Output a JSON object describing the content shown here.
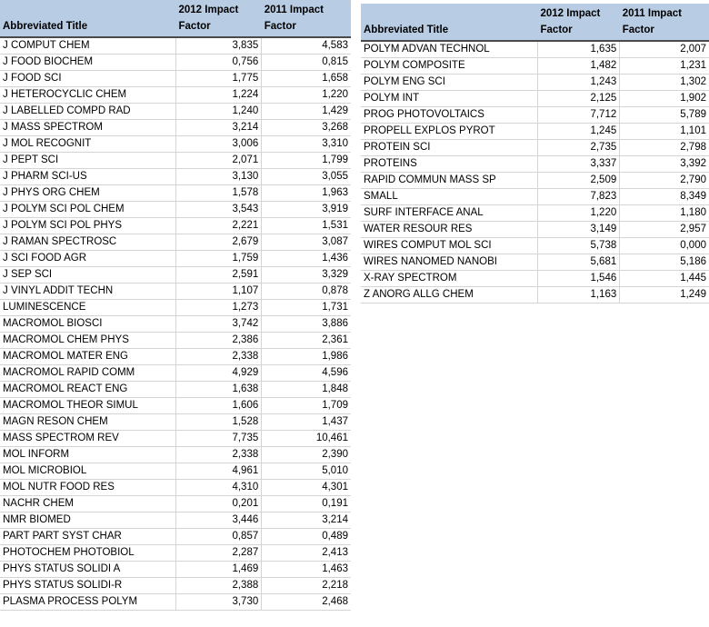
{
  "headers": {
    "title": "Abbreviated Title",
    "col2012_line1": "2012 Impact",
    "col2012_line2": "Factor",
    "col2011_line1": "2011 Impact",
    "col2011_line2": "Factor"
  },
  "left_table": [
    {
      "title": "J COMPUT CHEM",
      "if2012": "3,835",
      "if2011": "4,583"
    },
    {
      "title": "J FOOD BIOCHEM",
      "if2012": "0,756",
      "if2011": "0,815"
    },
    {
      "title": "J FOOD SCI",
      "if2012": "1,775",
      "if2011": "1,658"
    },
    {
      "title": "J HETEROCYCLIC CHEM",
      "if2012": "1,224",
      "if2011": "1,220"
    },
    {
      "title": "J LABELLED COMPD RAD",
      "if2012": "1,240",
      "if2011": "1,429"
    },
    {
      "title": "J MASS SPECTROM",
      "if2012": "3,214",
      "if2011": "3,268"
    },
    {
      "title": "J MOL RECOGNIT",
      "if2012": "3,006",
      "if2011": "3,310"
    },
    {
      "title": "J PEPT SCI",
      "if2012": "2,071",
      "if2011": "1,799"
    },
    {
      "title": "J PHARM SCI-US",
      "if2012": "3,130",
      "if2011": "3,055"
    },
    {
      "title": "J PHYS ORG CHEM",
      "if2012": "1,578",
      "if2011": "1,963"
    },
    {
      "title": "J POLYM SCI POL CHEM",
      "if2012": "3,543",
      "if2011": "3,919"
    },
    {
      "title": "J POLYM SCI POL PHYS",
      "if2012": "2,221",
      "if2011": "1,531"
    },
    {
      "title": "J RAMAN SPECTROSC",
      "if2012": "2,679",
      "if2011": "3,087"
    },
    {
      "title": "J SCI FOOD AGR",
      "if2012": "1,759",
      "if2011": "1,436"
    },
    {
      "title": "J SEP SCI",
      "if2012": "2,591",
      "if2011": "3,329"
    },
    {
      "title": "J VINYL ADDIT TECHN",
      "if2012": "1,107",
      "if2011": "0,878"
    },
    {
      "title": "LUMINESCENCE",
      "if2012": "1,273",
      "if2011": "1,731"
    },
    {
      "title": "MACROMOL BIOSCI",
      "if2012": "3,742",
      "if2011": "3,886"
    },
    {
      "title": "MACROMOL CHEM PHYS",
      "if2012": "2,386",
      "if2011": "2,361"
    },
    {
      "title": "MACROMOL MATER ENG",
      "if2012": "2,338",
      "if2011": "1,986"
    },
    {
      "title": "MACROMOL RAPID COMM",
      "if2012": "4,929",
      "if2011": "4,596"
    },
    {
      "title": "MACROMOL REACT ENG",
      "if2012": "1,638",
      "if2011": "1,848"
    },
    {
      "title": "MACROMOL THEOR SIMUL",
      "if2012": "1,606",
      "if2011": "1,709"
    },
    {
      "title": "MAGN RESON CHEM",
      "if2012": "1,528",
      "if2011": "1,437"
    },
    {
      "title": "MASS SPECTROM REV",
      "if2012": "7,735",
      "if2011": "10,461"
    },
    {
      "title": "MOL INFORM",
      "if2012": "2,338",
      "if2011": "2,390"
    },
    {
      "title": "MOL MICROBIOL",
      "if2012": "4,961",
      "if2011": "5,010"
    },
    {
      "title": "MOL NUTR FOOD RES",
      "if2012": "4,310",
      "if2011": "4,301"
    },
    {
      "title": "NACHR CHEM",
      "if2012": "0,201",
      "if2011": "0,191"
    },
    {
      "title": "NMR BIOMED",
      "if2012": "3,446",
      "if2011": "3,214"
    },
    {
      "title": "PART PART SYST CHAR",
      "if2012": "0,857",
      "if2011": "0,489"
    },
    {
      "title": "PHOTOCHEM PHOTOBIOL",
      "if2012": "2,287",
      "if2011": "2,413"
    },
    {
      "title": "PHYS STATUS SOLIDI A",
      "if2012": "1,469",
      "if2011": "1,463"
    },
    {
      "title": "PHYS STATUS SOLIDI-R",
      "if2012": "2,388",
      "if2011": "2,218"
    },
    {
      "title": "PLASMA PROCESS POLYM",
      "if2012": "3,730",
      "if2011": "2,468"
    }
  ],
  "right_table": [
    {
      "title": "POLYM ADVAN TECHNOL",
      "if2012": "1,635",
      "if2011": "2,007"
    },
    {
      "title": "POLYM COMPOSITE",
      "if2012": "1,482",
      "if2011": "1,231"
    },
    {
      "title": "POLYM ENG SCI",
      "if2012": "1,243",
      "if2011": "1,302"
    },
    {
      "title": "POLYM INT",
      "if2012": "2,125",
      "if2011": "1,902"
    },
    {
      "title": "PROG PHOTOVOLTAICS",
      "if2012": "7,712",
      "if2011": "5,789"
    },
    {
      "title": "PROPELL EXPLOS PYROT",
      "if2012": "1,245",
      "if2011": "1,101"
    },
    {
      "title": "PROTEIN SCI",
      "if2012": "2,735",
      "if2011": "2,798"
    },
    {
      "title": "PROTEINS",
      "if2012": "3,337",
      "if2011": "3,392"
    },
    {
      "title": "RAPID COMMUN MASS SP",
      "if2012": "2,509",
      "if2011": "2,790"
    },
    {
      "title": "SMALL",
      "if2012": "7,823",
      "if2011": "8,349"
    },
    {
      "title": "SURF INTERFACE ANAL",
      "if2012": "1,220",
      "if2011": "1,180"
    },
    {
      "title": "WATER RESOUR RES",
      "if2012": "3,149",
      "if2011": "2,957"
    },
    {
      "title": "WIRES COMPUT MOL SCI",
      "if2012": "5,738",
      "if2011": "0,000"
    },
    {
      "title": "WIRES NANOMED NANOBI",
      "if2012": "5,681",
      "if2011": "5,186"
    },
    {
      "title": "X-RAY SPECTROM",
      "if2012": "1,546",
      "if2011": "1,445"
    },
    {
      "title": "Z ANORG ALLG CHEM",
      "if2012": "1,163",
      "if2011": "1,249"
    }
  ]
}
